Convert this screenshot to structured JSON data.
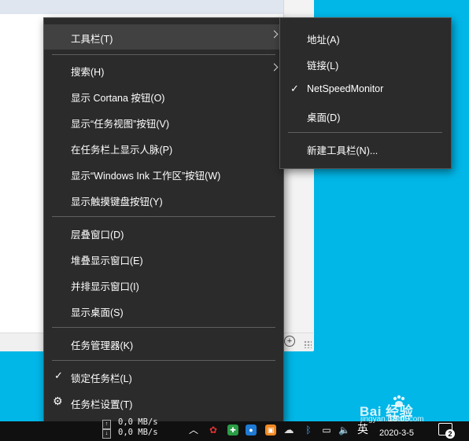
{
  "main_menu": {
    "items": [
      {
        "label": "工具栏(T)",
        "submenu": true,
        "active": true
      },
      {
        "label": "搜索(H)",
        "submenu": true
      },
      {
        "label": "显示 Cortana 按钮(O)"
      },
      {
        "label": "显示“任务视图”按钮(V)"
      },
      {
        "label": "在任务栏上显示人脉(P)"
      },
      {
        "label": "显示“Windows Ink 工作区”按钮(W)"
      },
      {
        "label": "显示触摸键盘按钮(Y)"
      },
      {
        "label": "层叠窗口(D)"
      },
      {
        "label": "堆叠显示窗口(E)"
      },
      {
        "label": "并排显示窗口(I)"
      },
      {
        "label": "显示桌面(S)"
      },
      {
        "label": "任务管理器(K)"
      },
      {
        "label": "锁定任务栏(L)",
        "checked": true
      },
      {
        "label": "任务栏设置(T)",
        "icon": "gear-icon"
      }
    ]
  },
  "toolbar_submenu": {
    "items": [
      {
        "label": "地址(A)"
      },
      {
        "label": "链接(L)"
      },
      {
        "label": "NetSpeedMonitor",
        "checked": true
      },
      {
        "label": "桌面(D)"
      },
      {
        "label": "新建工具栏(N)..."
      }
    ]
  },
  "taskbar": {
    "net_up": "0,0 MB/s",
    "net_down": "0,0 MB/s",
    "ime": "英",
    "time": "18:09",
    "date": "2020-3-5",
    "notification_count": "2"
  },
  "window": {
    "zoom_icon": "⊕"
  },
  "watermark": {
    "brand": "Bai 经验",
    "url": "jingyan.baidu.com"
  },
  "colors": {
    "menu_bg": "#2b2b2b",
    "menu_hover": "#414141",
    "desktop": "#00b7e8",
    "taskbar": "#101010"
  }
}
